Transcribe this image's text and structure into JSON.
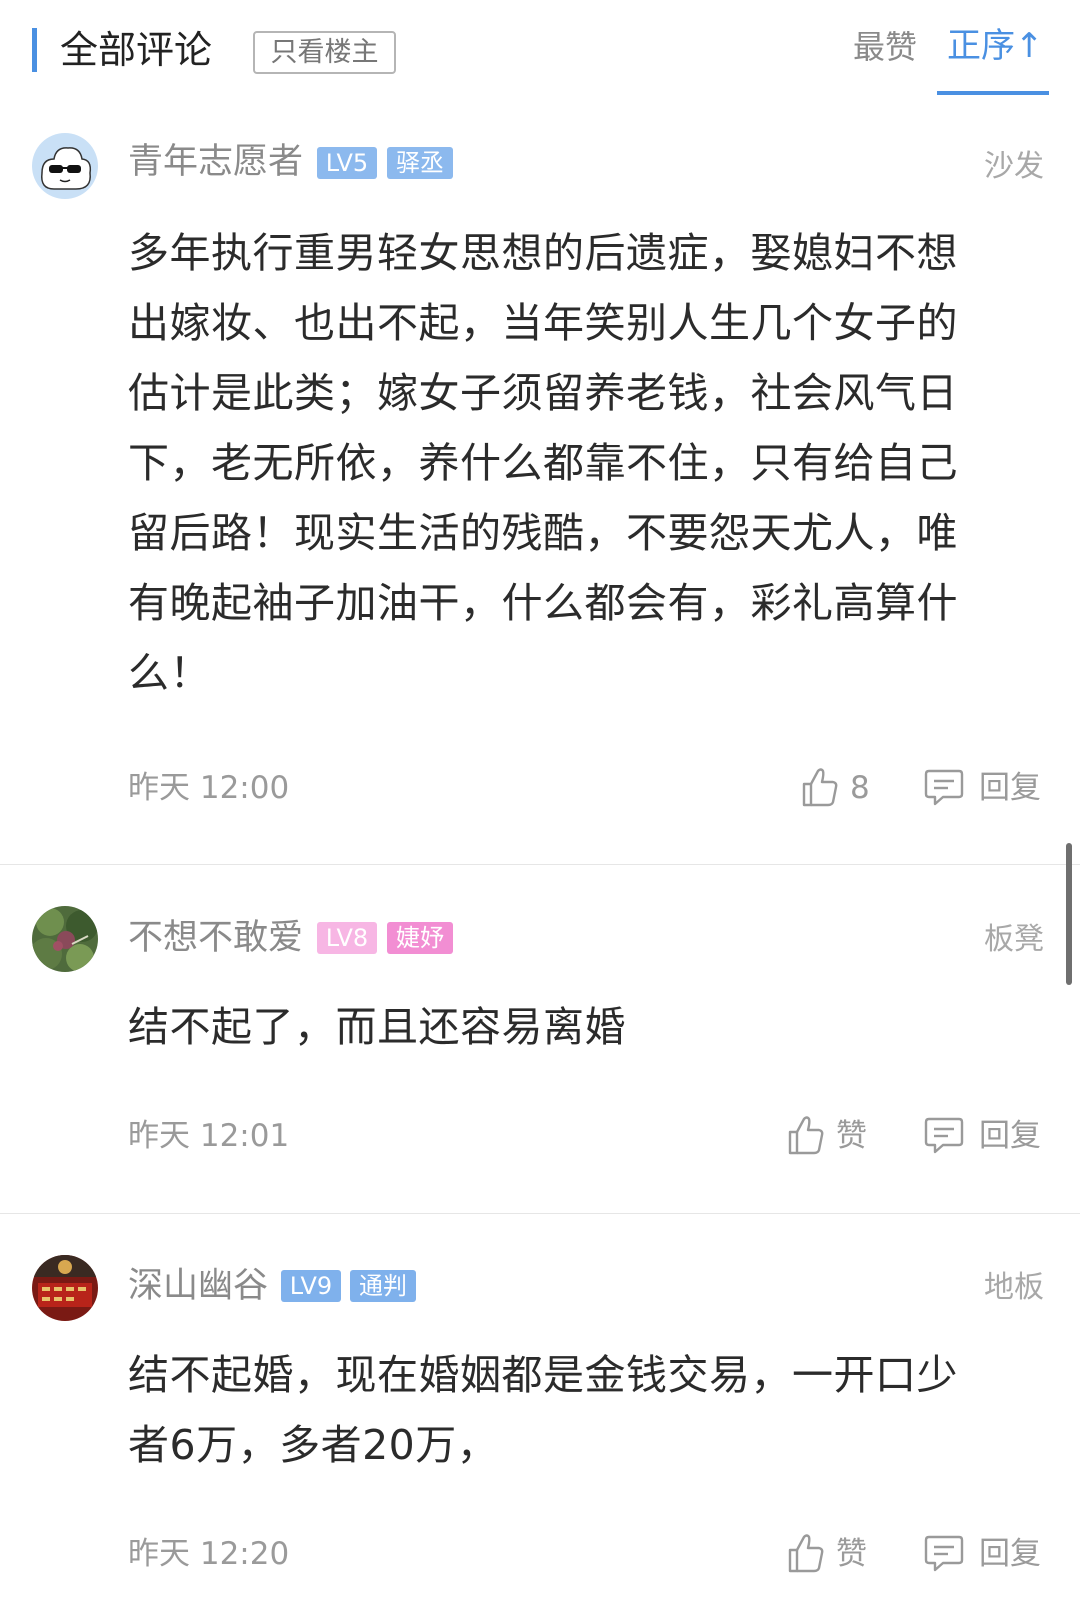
{
  "header": {
    "title": "全部评论",
    "filter_label": "只看楼主",
    "sort_hot": "最赞",
    "sort_asc": "正序↑",
    "accent_color": "#4a90e2"
  },
  "comments": [
    {
      "username": "青年志愿者",
      "level": "LV5",
      "title": "驿丞",
      "level_color": "#8cb9ee",
      "title_color": "#8cb9ee",
      "floor": "沙发",
      "content": "多年执行重男轻女思想的后遗症，娶媳妇不想出嫁妆、也出不起，当年笑别人生几个女子的估计是此类；嫁女子须留养老钱，社会风气日下，老无所依，养什么都靠不住，只有给自己留后路！现实生活的残酷，不要怨天尤人，唯有晚起袖子加油干，什么都会有，彩礼高算什么！",
      "time": "昨天 12:00",
      "likes": "8",
      "reply": "回复",
      "avatar": "cloud-sunglasses-avatar"
    },
    {
      "username": "不想不敢爱",
      "level": "LV8",
      "title": "婕妤",
      "level_color": "#f7b6e4",
      "title_color": "#f28ed3",
      "floor": "板凳",
      "content": "结不起了，而且还容易离婚",
      "time": "昨天 12:01",
      "likes": "赞",
      "reply": "回复",
      "avatar": "plant-photo-avatar"
    },
    {
      "username": "深山幽谷",
      "level": "LV9",
      "title": "通判",
      "level_color": "#7fb1ec",
      "title_color": "#7fb1ec",
      "floor": "地板",
      "content": "结不起婚，现在婚姻都是金钱交易，一开口少者6万，多者20万，",
      "time": "昨天 12:20",
      "likes": "赞",
      "reply": "回复",
      "avatar": "red-emblem-avatar"
    }
  ]
}
